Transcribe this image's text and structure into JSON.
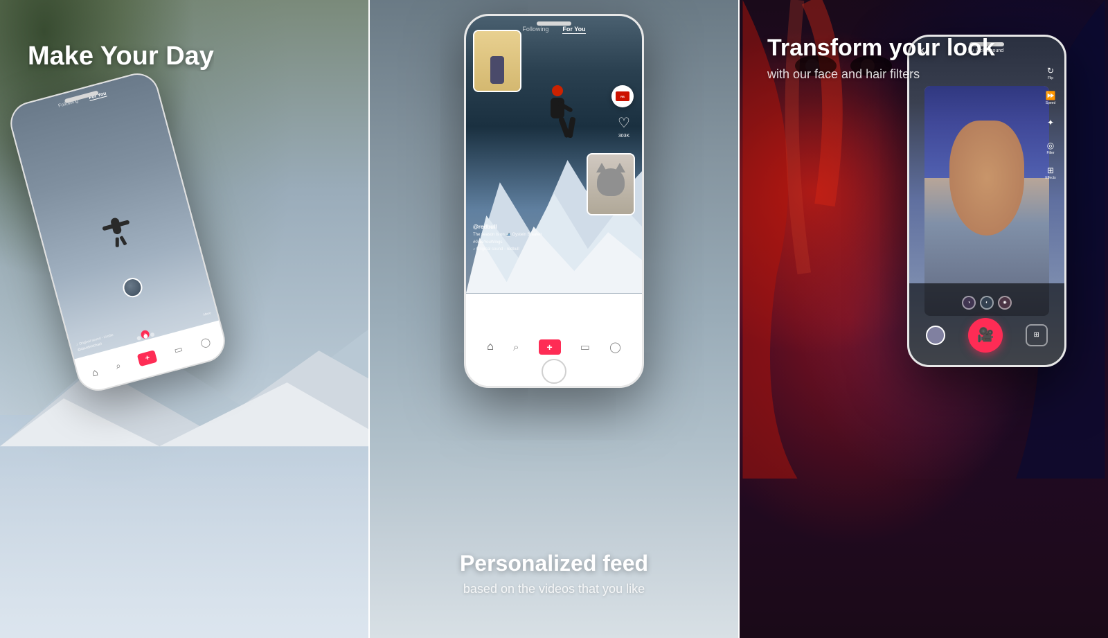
{
  "panel1": {
    "headline": "Make Your Day",
    "phone": {
      "tab_following": "Following",
      "tab_for_you": "For You",
      "username": "@davidrmichael",
      "sound": "Original sound - Linslie",
      "more": "More"
    }
  },
  "panel2": {
    "phone": {
      "tab_following": "Following",
      "tab_for_you": "For You",
      "username": "@redbull",
      "description": "The season is on 🎿 Oystein Braaten",
      "hashtag": "#GiveYouWings",
      "sound": "♪ Original sound - redbull",
      "heart_count": "303K"
    },
    "title": "Personalized feed",
    "subtitle": "based on the videos that you like"
  },
  "panel3": {
    "headline": "Transform your look",
    "subtitle": "with our face and hair filters",
    "phone": {
      "sound_label": "♪ Pick a sound",
      "flip_label": "Flip",
      "speed_label": "Speed",
      "filter_label": "Filter",
      "effects_label": "Effects"
    }
  }
}
